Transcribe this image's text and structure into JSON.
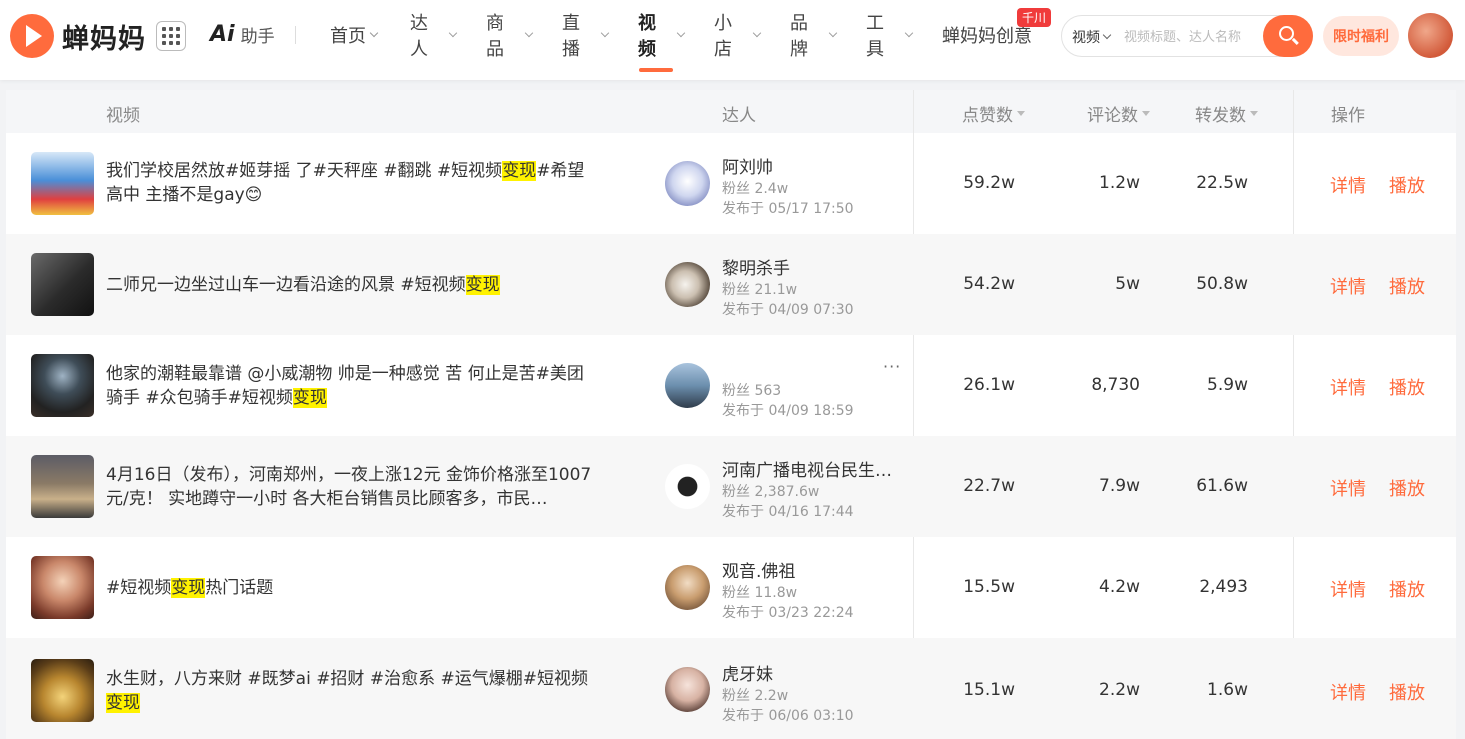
{
  "brand": {
    "name": "蝉妈妈"
  },
  "ai": {
    "mark": "Ai",
    "label": "助手"
  },
  "nav": [
    {
      "label": "首页",
      "active": false
    },
    {
      "label": "达人",
      "active": false
    },
    {
      "label": "商品",
      "active": false
    },
    {
      "label": "直播",
      "active": false
    },
    {
      "label": "视频",
      "active": true
    },
    {
      "label": "小店",
      "active": false
    },
    {
      "label": "品牌",
      "active": false
    },
    {
      "label": "工具",
      "active": false
    },
    {
      "label": "蝉妈妈创意",
      "active": false,
      "badge": "千川"
    }
  ],
  "search": {
    "scope": "视频",
    "placeholder": "视频标题、达人名称"
  },
  "promo": "限时福利",
  "table": {
    "headers": {
      "video": "视频",
      "creator": "达人",
      "likes": "点赞数",
      "comments": "评论数",
      "shares": "转发数",
      "actions": "操作"
    },
    "rows": [
      {
        "title_pre": "我们学校居然放#姬芽摇 了#天秤座 #翻跳 #短视频",
        "highlight": "变现",
        "title_post": "#希望高中 主播不是gay😊",
        "name": "阿刘帅",
        "fans": "粉丝 2.4w",
        "date": "发布于 05/17 17:50",
        "likes": "59.2w",
        "comments": "1.2w",
        "shares": "22.5w",
        "detail": "详情",
        "play": "播放"
      },
      {
        "title_pre": "二师兄一边坐过山车一边看沿途的风景 #短视频",
        "highlight": "变现",
        "title_post": "",
        "name": "黎明杀手",
        "fans": "粉丝 21.1w",
        "date": "发布于 04/09 07:30",
        "likes": "54.2w",
        "comments": "5w",
        "shares": "50.8w",
        "detail": "详情",
        "play": "播放"
      },
      {
        "title_pre": "他家的潮鞋最靠谱 @小威潮物 帅是一种感觉 苦 何止是苦#美团骑手 #众包骑手#短视频",
        "highlight": "变现",
        "title_post": "",
        "name": "",
        "fans": "粉丝 563",
        "date": "发布于 04/09 18:59",
        "likes": "26.1w",
        "comments": "8,730",
        "shares": "5.9w",
        "detail": "详情",
        "play": "播放",
        "more": "···"
      },
      {
        "title_pre": "4月16日（发布），河南郑州，一夜上涨12元 金饰价格涨至1007元/克！ 实地蹲守一小时 各大柜台销售员比顾客多，市民…",
        "highlight": "",
        "title_post": "",
        "name": "河南广播电视台民生…",
        "fans": "粉丝 2,387.6w",
        "date": "发布于 04/16 17:44",
        "likes": "22.7w",
        "comments": "7.9w",
        "shares": "61.6w",
        "detail": "详情",
        "play": "播放"
      },
      {
        "title_pre": "#短视频",
        "highlight": "变现",
        "title_post": "热门话题",
        "name": "观音.佛祖",
        "fans": "粉丝 11.8w",
        "date": "发布于 03/23 22:24",
        "likes": "15.5w",
        "comments": "4.2w",
        "shares": "2,493",
        "detail": "详情",
        "play": "播放"
      },
      {
        "title_pre": "水生财，八方来财 #既梦ai #招财 #治愈系 #运气爆棚#短视频",
        "highlight": "变现",
        "title_post": "",
        "name": "虎牙妹",
        "fans": "粉丝 2.2w",
        "date": "发布于 06/06 03:10",
        "likes": "15.1w",
        "comments": "2.2w",
        "shares": "1.6w",
        "detail": "详情",
        "play": "播放"
      }
    ]
  },
  "colors": {
    "accent": "#ff6b3d",
    "highlight": "#fff200",
    "badge": "#f03b3b"
  }
}
